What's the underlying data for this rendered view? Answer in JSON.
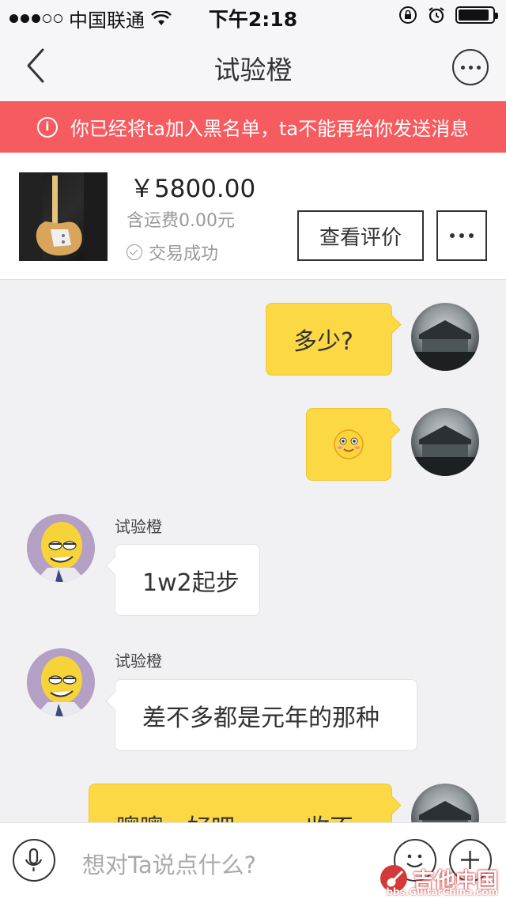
{
  "status_bar": {
    "carrier": "中国联通",
    "time": "下午2:18"
  },
  "nav": {
    "title": "试验橙"
  },
  "banner": {
    "text": "你已经将ta加入黑名单，ta不能再给你发送消息"
  },
  "product": {
    "price": "￥5800.00",
    "freight": "含运费0.00元",
    "status": "交易成功",
    "review_button": "查看评价"
  },
  "messages": [
    {
      "from": "self",
      "text": "多少?"
    },
    {
      "from": "self",
      "text": "",
      "emoji": "smiley-face"
    },
    {
      "from": "other",
      "sender": "试验橙",
      "text": "1w2起步"
    },
    {
      "from": "other",
      "sender": "试验橙",
      "text": "差不多都是元年的那种"
    },
    {
      "from": "self",
      "text": "噢噢，好吧………收不"
    }
  ],
  "input": {
    "placeholder": "想对Ta说点什么?"
  },
  "watermark": {
    "text": "吉他中国",
    "sub": "bbs.GuitarChina.com"
  },
  "colors": {
    "banner": "#f55b5f",
    "self_bubble": "#fcd845",
    "background": "#f1f1f4"
  }
}
